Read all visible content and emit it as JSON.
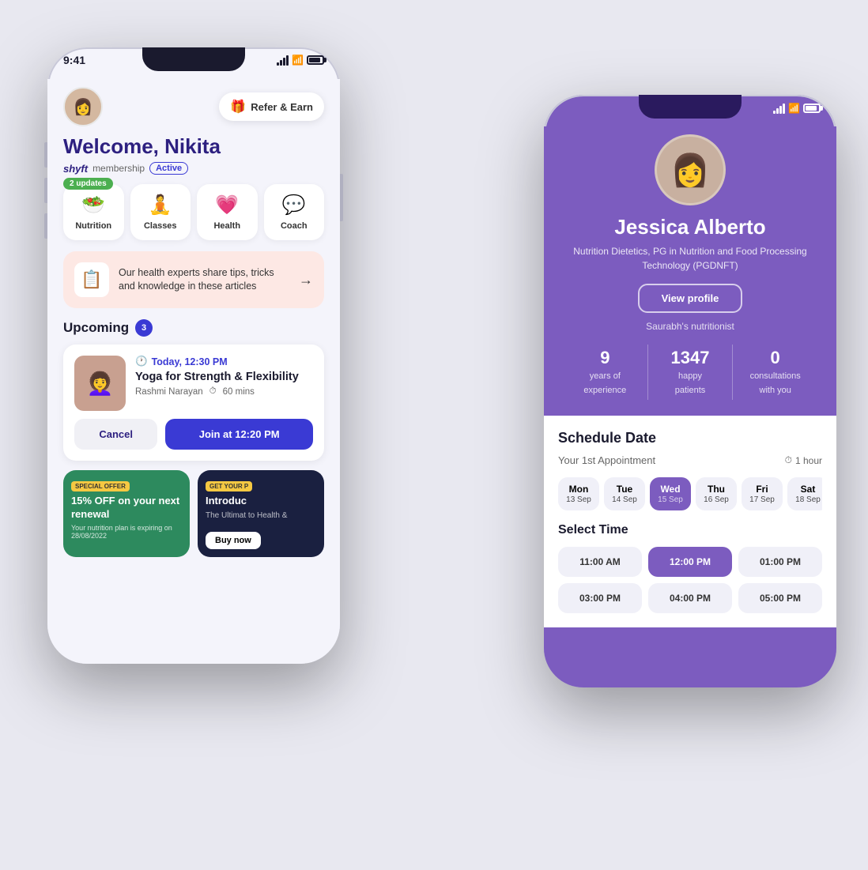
{
  "left_phone": {
    "status_time": "9:41",
    "welcome": "Welcome, Nikita",
    "shyft_label": "shyft",
    "membership_label": "membership",
    "active_label": "Active",
    "updates_badge": "2 updates",
    "categories": [
      {
        "id": "nutrition",
        "label": "Nutrition",
        "icon": "🥗"
      },
      {
        "id": "classes",
        "label": "Classes",
        "icon": "🧘"
      },
      {
        "id": "health",
        "label": "Health",
        "icon": "💗"
      },
      {
        "id": "coach",
        "label": "Coach",
        "icon": "💬"
      }
    ],
    "refer_earn": "Refer & Earn",
    "article": {
      "text": "Our health experts share tips, tricks and knowledge in these articles"
    },
    "upcoming_label": "Upcoming",
    "upcoming_count": "3",
    "session": {
      "time": "Today, 12:30 PM",
      "title": "Yoga for Strength & Flexibility",
      "instructor": "Rashmi Narayan",
      "duration": "60 mins",
      "cancel_label": "Cancel",
      "join_label": "Join at 12:20 PM"
    },
    "promo1": {
      "badge": "SPECIAL OFFER",
      "title": "15% OFF on your next renewal",
      "sub": "Your nutrition plan is expiring on 28/08/2022"
    },
    "promo2": {
      "badge": "GET YOUR P",
      "title": "Introduc",
      "sub": "The Ultimat to Health &"
    }
  },
  "right_phone": {
    "status_time": "",
    "coach_name": "Jessica Alberto",
    "coach_credentials": "Nutrition Dietetics, PG in Nutrition and Food\nProcessing Technology (PGDNFT)",
    "view_profile": "View profile",
    "nutritionist_of": "Saurabh's nutritionist",
    "stats": [
      {
        "num": "9",
        "label": "years of\nexperience"
      },
      {
        "num": "1347",
        "label": "happy\npatients"
      },
      {
        "num": "0",
        "label": "consultations\nwith you"
      }
    ],
    "schedule_title": "ate",
    "appointment_label": "Your 1st Appointment",
    "duration_label": "1 hour",
    "dates": [
      {
        "day": "Mon",
        "date": "13 Sep",
        "active": false
      },
      {
        "day": "Tue",
        "date": "14 Sep",
        "active": false
      },
      {
        "day": "Wed",
        "date": "15 Sep",
        "active": true
      },
      {
        "day": "Thu",
        "date": "16 Sep",
        "active": false
      },
      {
        "day": "Fri",
        "date": "17 Sep",
        "active": false
      },
      {
        "day": "Sat",
        "date": "18 Sep",
        "active": false
      }
    ],
    "time_section": "ime",
    "times": [
      {
        "label": "11:00 AM",
        "active": false
      },
      {
        "label": "12:00 PM",
        "active": true
      },
      {
        "label": "01:00 PM",
        "active": false
      },
      {
        "label": "03:00 PM",
        "active": false
      },
      {
        "label": "04:00 PM",
        "active": false
      },
      {
        "label": "05:00 PM",
        "active": false
      }
    ]
  }
}
